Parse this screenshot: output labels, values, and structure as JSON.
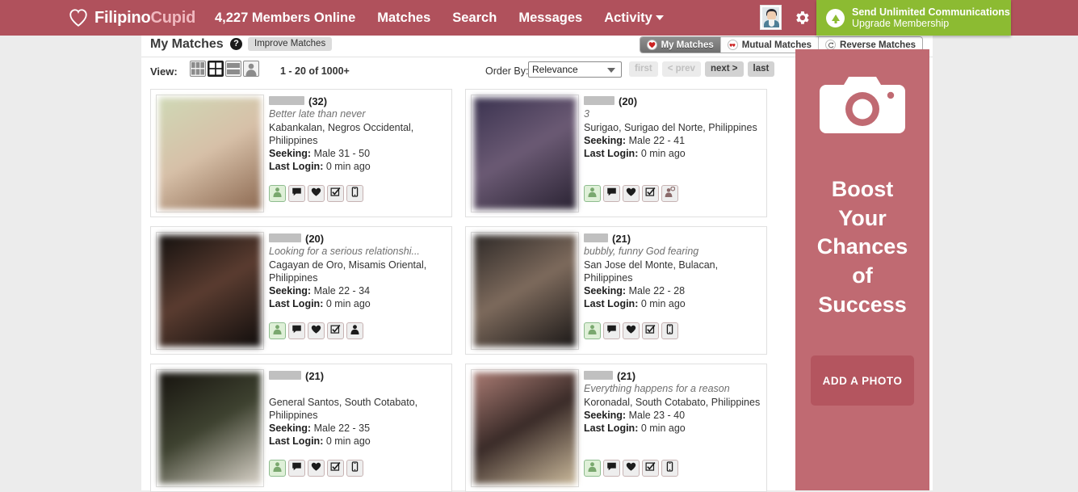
{
  "brand": {
    "name_first": "Filipino",
    "name_second": "Cupid",
    "heart_icon": "heart-icon"
  },
  "nav": {
    "members_online": "4,227 Members Online",
    "matches": "Matches",
    "search": "Search",
    "messages": "Messages",
    "activity": "Activity",
    "avatar_icon": "user-avatar-icon",
    "gear_icon": "gear-icon"
  },
  "upgrade": {
    "line1": "Send Unlimited Communications",
    "line2": "Upgrade Membership",
    "icon": "up-arrow-circle-icon",
    "color": "#8cbb32"
  },
  "matches_header": {
    "title": "My Matches",
    "help_icon": "question-mark-icon",
    "improve_label": "Improve Matches",
    "tabs": [
      {
        "label": "My Matches",
        "icon": "heart-icon",
        "active": true
      },
      {
        "label": "Mutual Matches",
        "icon": "two-hearts-icon",
        "active": false
      },
      {
        "label": "Reverse Matches",
        "icon": "reverse-arrow-icon",
        "active": false
      }
    ]
  },
  "toolbar": {
    "view_label": "View:",
    "view_options": [
      {
        "name": "grid-small-view",
        "active": false
      },
      {
        "name": "grid-large-view",
        "active": true
      },
      {
        "name": "list-view",
        "active": false
      },
      {
        "name": "gallery-view",
        "active": false
      }
    ],
    "count_text": "1 - 20 of 1000+",
    "orderby_label": "Order By:",
    "orderby_value": "Relevance",
    "pager": [
      {
        "label": "first",
        "disabled": true
      },
      {
        "label": "< prev",
        "disabled": true
      },
      {
        "label": "next >",
        "disabled": false
      },
      {
        "label": "last",
        "disabled": false
      }
    ]
  },
  "cards": [
    {
      "name_redacted_width": 44,
      "age": "(32)",
      "tagline": "Better late than never",
      "location": "Kabankalan, Negros Occidental, Philippines",
      "seeking_label": "Seeking:",
      "seeking_value": "Male 31 - 50",
      "lastlogin_label": "Last Login:",
      "lastlogin_value": "0 min ago",
      "photo_colors": [
        "#cfd8b5",
        "#d7c0a8",
        "#8d6a52"
      ],
      "actions": [
        "view-profile-icon",
        "message-icon",
        "favorite-heart-icon",
        "checklist-icon",
        "mobile-phone-icon"
      ]
    },
    {
      "name_redacted_width": 38,
      "age": "(20)",
      "tagline": "3",
      "location": "Surigao, Surigao del Norte, Philippines",
      "seeking_label": "Seeking:",
      "seeking_value": "Male 22 - 41",
      "lastlogin_label": "Last Login:",
      "lastlogin_value": "0 min ago",
      "photo_colors": [
        "#3b3350",
        "#6b5a74",
        "#2a2333"
      ],
      "actions": [
        "view-profile-icon",
        "message-icon",
        "favorite-heart-icon",
        "checklist-icon",
        "person-chat-icon"
      ]
    },
    {
      "name_redacted_width": 40,
      "age": "(20)",
      "tagline": "Looking for a serious relationshi...",
      "location": "Cagayan de Oro, Misamis Oriental, Philippines",
      "seeking_label": "Seeking:",
      "seeking_value": "Male 22 - 34",
      "lastlogin_label": "Last Login:",
      "lastlogin_value": "0 min ago",
      "photo_colors": [
        "#15110f",
        "#5a3c30",
        "#100d0c"
      ],
      "actions": [
        "view-profile-icon",
        "message-icon",
        "favorite-heart-icon",
        "checklist-icon",
        "person-icon"
      ]
    },
    {
      "name_redacted_width": 30,
      "age": "(21)",
      "tagline": "bubbly, funny God fearing",
      "location": "San Jose del Monte, Bulacan, Philippines",
      "seeking_label": "Seeking:",
      "seeking_value": "Male 22 - 28",
      "lastlogin_label": "Last Login:",
      "lastlogin_value": "0 min ago",
      "photo_colors": [
        "#2f2a28",
        "#7d6a5c",
        "#1b1817"
      ],
      "actions": [
        "view-profile-icon",
        "message-icon",
        "favorite-heart-icon",
        "checklist-icon",
        "mobile-phone-icon"
      ]
    },
    {
      "name_redacted_width": 40,
      "age": "(21)",
      "tagline": "",
      "location": "General Santos, South Cotabato, Philippines",
      "seeking_label": "Seeking:",
      "seeking_value": "Male 22 - 35",
      "lastlogin_label": "Last Login:",
      "lastlogin_value": "0 min ago",
      "photo_colors": [
        "#17140f",
        "#3e4230",
        "#d8d2c8"
      ],
      "actions": [
        "view-profile-icon",
        "message-icon",
        "favorite-heart-icon",
        "checklist-icon",
        "mobile-phone-icon"
      ]
    },
    {
      "name_redacted_width": 36,
      "age": "(21)",
      "tagline": "Everything happens for a reason",
      "location": "Koronadal, South Cotabato, Philippines",
      "seeking_label": "Seeking:",
      "seeking_value": "Male 23 - 40",
      "lastlogin_label": "Last Login:",
      "lastlogin_value": "0 min ago",
      "photo_colors": [
        "#a87a72",
        "#3a2b28",
        "#c9b89a"
      ],
      "actions": [
        "view-profile-icon",
        "message-icon",
        "favorite-heart-icon",
        "checklist-icon",
        "mobile-phone-icon"
      ]
    }
  ],
  "promo": {
    "camera_icon": "camera-icon",
    "headline": "Boost\nYour\nChances\nof\nSuccess",
    "button_label": "ADD A PHOTO",
    "bg_color": "#c06a72"
  }
}
